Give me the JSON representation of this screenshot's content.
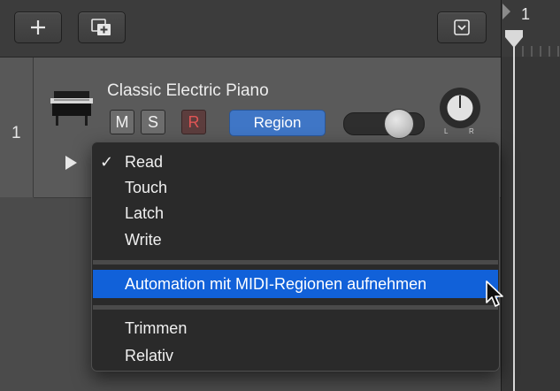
{
  "toolbar": {
    "buttons": [
      {
        "id": "add",
        "icon": "plus-icon"
      },
      {
        "id": "duplicate",
        "icon": "duplicate-track-icon"
      },
      {
        "id": "view-menu",
        "icon": "chevron-down-box-icon"
      }
    ]
  },
  "ruler": {
    "bar_label": "1"
  },
  "track": {
    "number": "1",
    "name": "Classic Electric Piano",
    "icon": "electric-piano-icon",
    "mute_label": "M",
    "solo_label": "S",
    "record_label": "R",
    "automation_mode": "Region",
    "pan_left_label": "L",
    "pan_right_label": "R",
    "accent_color": "#3f76c6",
    "record_color": "#e05555"
  },
  "automation_menu": {
    "items_group1": [
      "Read",
      "Touch",
      "Latch",
      "Write"
    ],
    "checked_item": "Read",
    "highlighted_item": "Automation mit MIDI-Regionen aufnehmen",
    "items_group3": [
      "Trimmen",
      "Relativ"
    ],
    "highlight_color": "#1161d9"
  }
}
